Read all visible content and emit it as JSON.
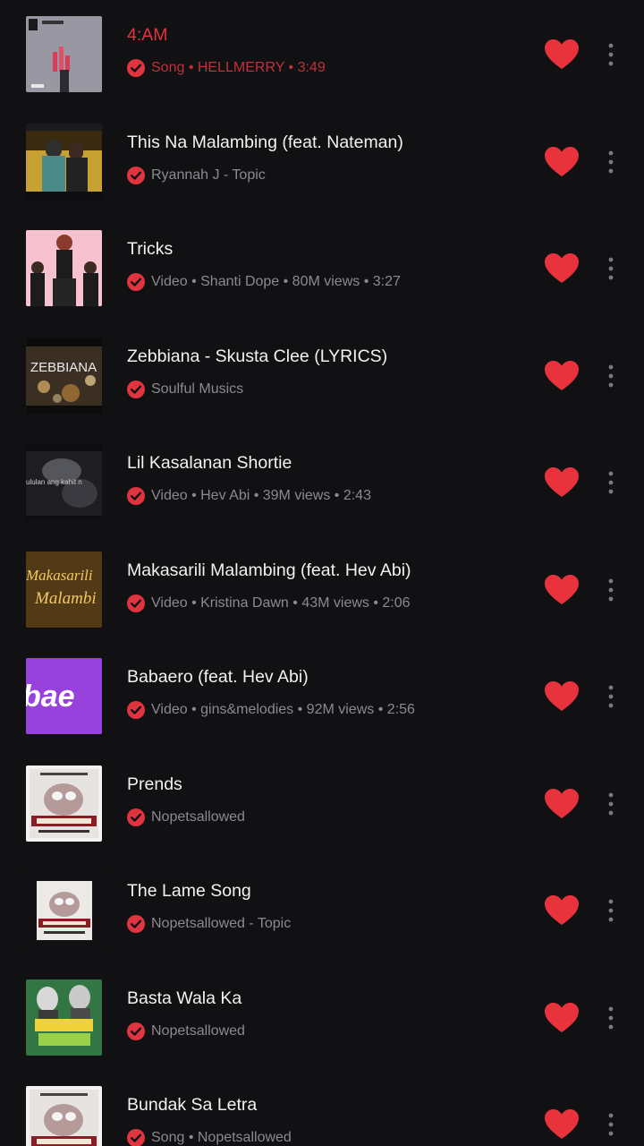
{
  "colors": {
    "background": "#111113",
    "accent": "#e0353f",
    "heart": "#e8323c",
    "text_primary": "#f2f2f2",
    "text_secondary": "#8b8b8f"
  },
  "songs": [
    {
      "title": "4:AM",
      "subtitle": "Song • HELLMERRY • 3:49",
      "thumb": "4am",
      "playing": true,
      "liked": true
    },
    {
      "title": "This Na Malambing (feat. Nateman)",
      "subtitle": "Ryannah J - Topic",
      "thumb": "malambing",
      "playing": false,
      "liked": true
    },
    {
      "title": "Tricks",
      "subtitle": "Video • Shanti Dope • 80M views • 3:27",
      "thumb": "tricks",
      "playing": false,
      "liked": true
    },
    {
      "title": "Zebbiana - Skusta Clee (LYRICS)",
      "subtitle": "Soulful Musics",
      "thumb": "zebbiana",
      "thumb_text": "ZEBBIANA",
      "playing": false,
      "liked": true
    },
    {
      "title": "Lil Kasalanan Shortie",
      "subtitle": "Video • Hev Abi • 39M views • 2:43",
      "thumb": "lil",
      "thumb_text": "ululan ang kahit n",
      "playing": false,
      "liked": true
    },
    {
      "title": "Makasarili Malambing (feat. Hev Abi)",
      "subtitle": "Video • Kristina Dawn • 43M views • 2:06",
      "thumb": "makasarili",
      "thumb_text": "Makasarili",
      "thumb_text2": "Malambi",
      "playing": false,
      "liked": true
    },
    {
      "title": "Babaero (feat. Hev Abi)",
      "subtitle": "Video • gins&melodies • 92M views • 2:56",
      "thumb": "babaero",
      "thumb_text": "bae",
      "playing": false,
      "liked": true
    },
    {
      "title": "Prends",
      "subtitle": "Nopetsallowed",
      "thumb": "realshot",
      "playing": false,
      "liked": true
    },
    {
      "title": "The Lame Song",
      "subtitle": "Nopetsallowed - Topic",
      "thumb": "realshot-small",
      "playing": false,
      "liked": true
    },
    {
      "title": "Basta Wala Ka",
      "subtitle": "Nopetsallowed",
      "thumb": "plants",
      "playing": false,
      "liked": true
    },
    {
      "title": "Bundak Sa Letra",
      "subtitle": "Song • Nopetsallowed",
      "thumb": "realshot",
      "playing": false,
      "liked": true
    }
  ],
  "icons": {
    "check": "check-circle-icon",
    "like": "heart-icon",
    "more": "more-vertical-icon"
  }
}
